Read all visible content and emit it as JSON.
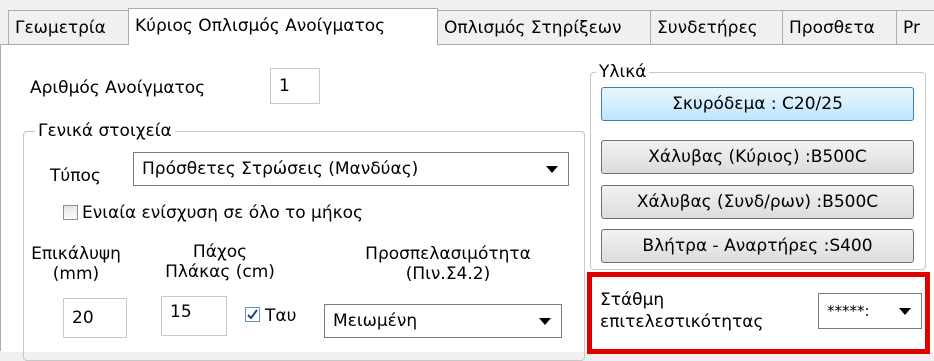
{
  "tabs": [
    {
      "label": "Γεωμετρία"
    },
    {
      "label": "Κύριος Οπλισμός Ανοίγματος"
    },
    {
      "label": "Οπλισμός Στηρίξεων"
    },
    {
      "label": "Συνδετήρες"
    },
    {
      "label": "Προσθετα"
    },
    {
      "label": "Pr"
    }
  ],
  "opening": {
    "label": "Αριθμός Ανοίγματος",
    "value": "1"
  },
  "general": {
    "title": "Γενικά στοιχεία",
    "type_label": "Τύπος",
    "type_value": "Πρόσθετες Στρώσεις (Μανδύας)",
    "uniform_label": "Ενιαία ενίσχυση σε όλο το μήκος",
    "uniform_checked": false,
    "cover_label_1": "Επικάλυψη",
    "cover_label_2": "(mm)",
    "cover_value": "20",
    "thickness_label_1": "Πάχος",
    "thickness_label_2": "Πλάκας (cm)",
    "thickness_value": "15",
    "tau_label": "Ταυ",
    "tau_checked": true,
    "access_label_1": "Προσπελασιμότητα",
    "access_label_2": "(Πιν.Σ4.2)",
    "access_value": "Μειωμένη"
  },
  "materials": {
    "title": "Υλικά",
    "concrete": "Σκυρόδεμα : C20/25",
    "steel_main": "Χάλυβας  (Κύριος) :B500C",
    "steel_stirrups": "Χάλυβας  (Συνδ/ρων) :B500C",
    "dowels": "Βλήτρα - Αναρτήρες :S400"
  },
  "performance": {
    "label_1": "Στάθμη",
    "label_2": "επιτελεστικότητας",
    "value": "*****:"
  },
  "colors": {
    "highlight": "#e00000",
    "focus_button": "#bee6fd"
  }
}
